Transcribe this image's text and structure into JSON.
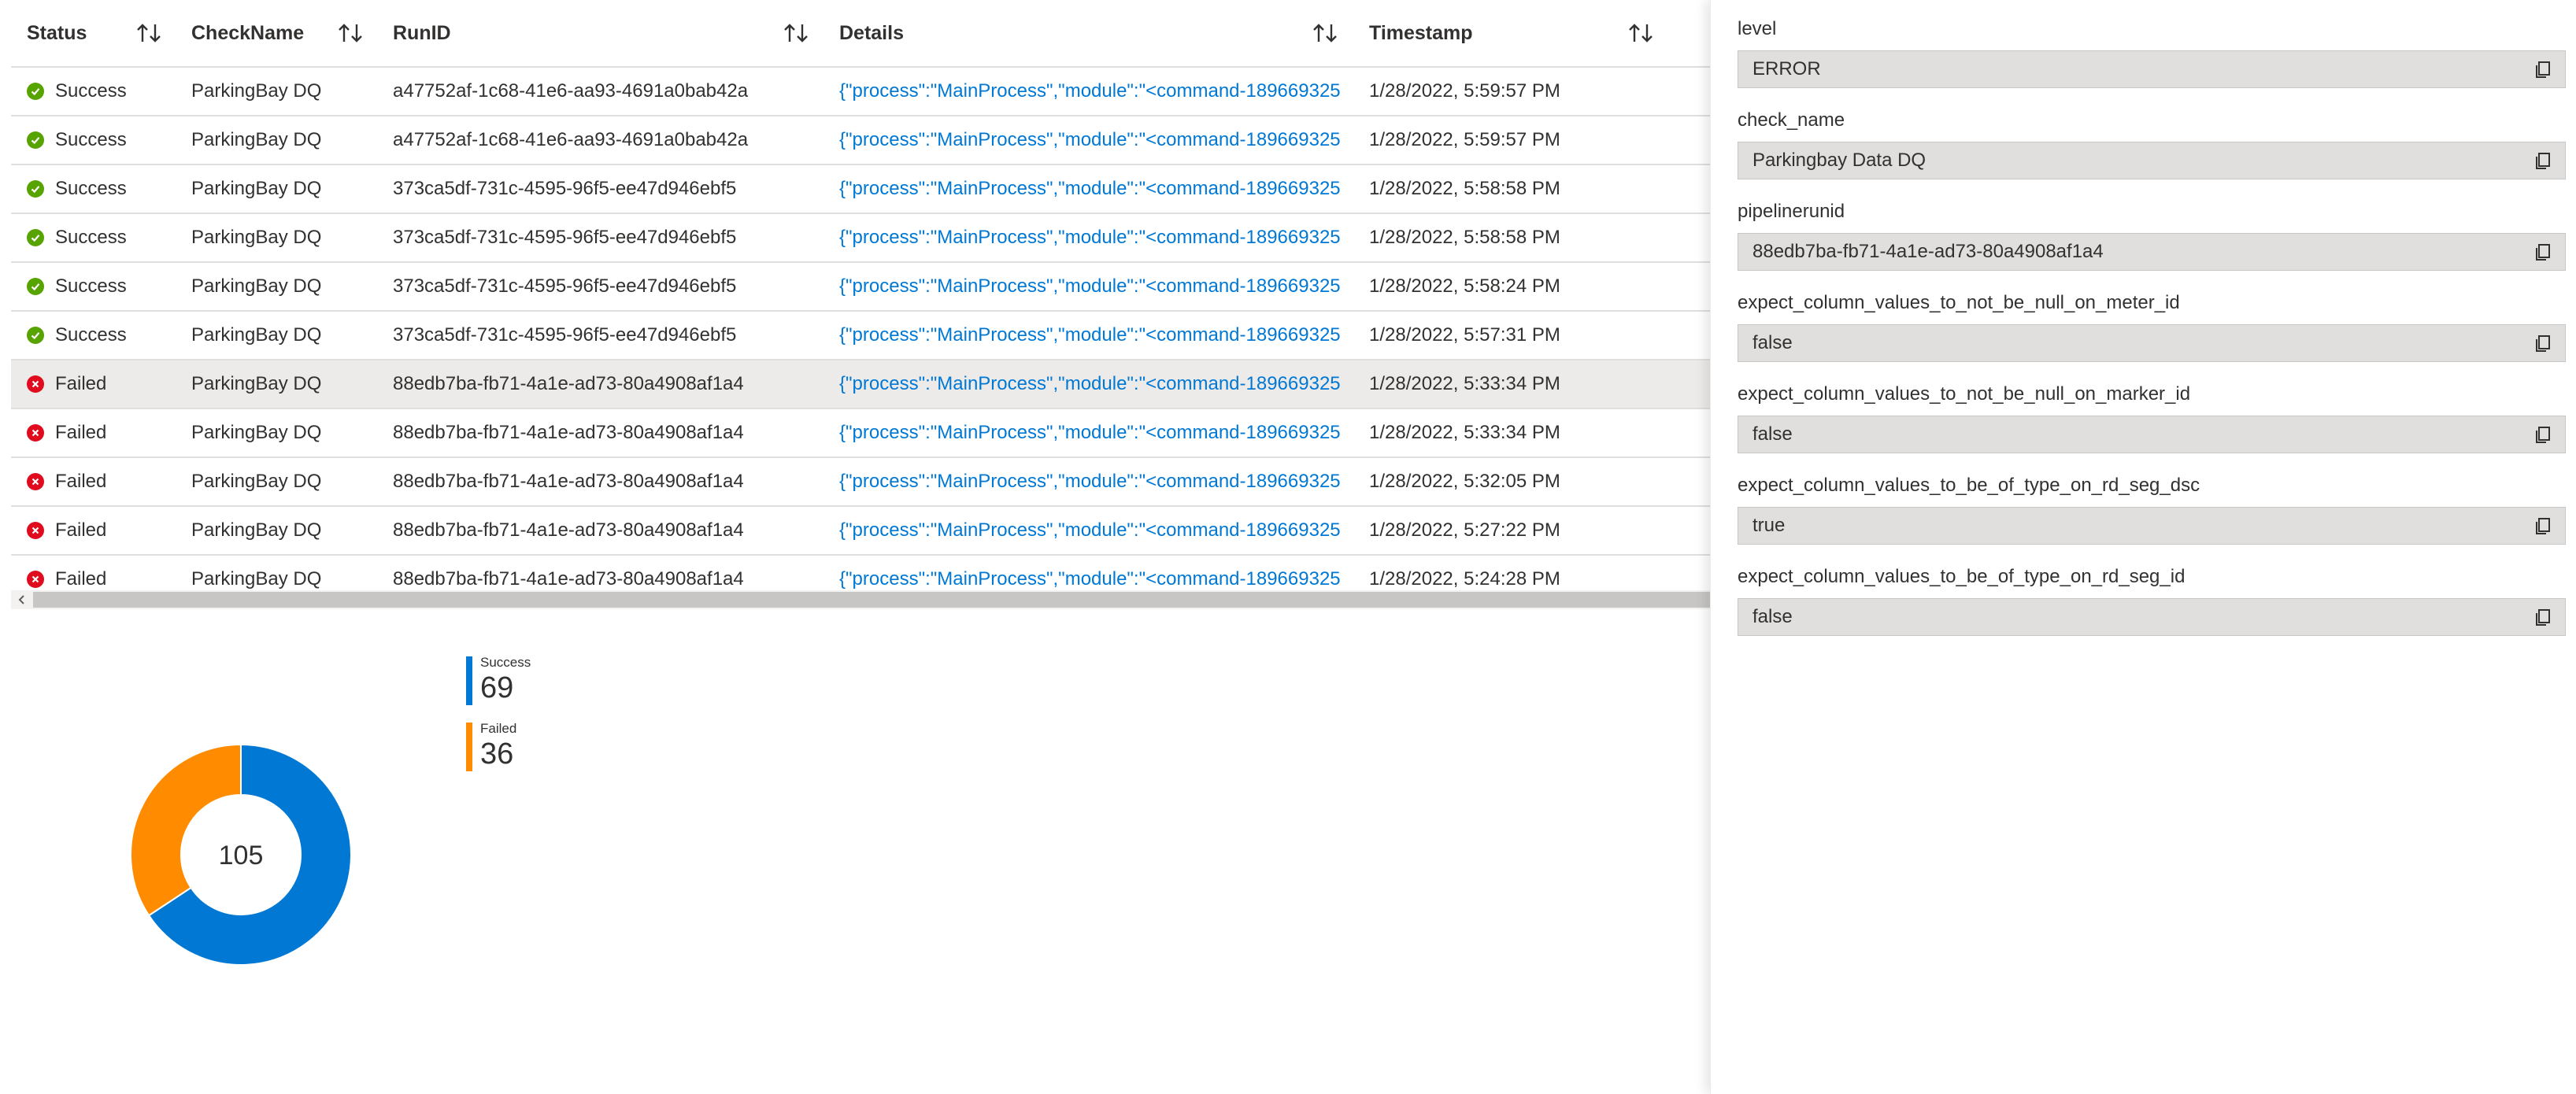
{
  "table": {
    "columns": [
      {
        "key": "status",
        "label": "Status"
      },
      {
        "key": "check",
        "label": "CheckName"
      },
      {
        "key": "run",
        "label": "RunID"
      },
      {
        "key": "details",
        "label": "Details"
      },
      {
        "key": "ts",
        "label": "Timestamp"
      }
    ],
    "rows": [
      {
        "status": "Success",
        "check": "ParkingBay DQ",
        "run": "a47752af-1c68-41e6-aa93-4691a0bab42a",
        "details": "{\"process\":\"MainProcess\",\"module\":\"<command-189669325",
        "ts": "1/28/2022, 5:59:57 PM",
        "ok": true,
        "selected": false
      },
      {
        "status": "Success",
        "check": "ParkingBay DQ",
        "run": "a47752af-1c68-41e6-aa93-4691a0bab42a",
        "details": "{\"process\":\"MainProcess\",\"module\":\"<command-189669325",
        "ts": "1/28/2022, 5:59:57 PM",
        "ok": true,
        "selected": false
      },
      {
        "status": "Success",
        "check": "ParkingBay DQ",
        "run": "373ca5df-731c-4595-96f5-ee47d946ebf5",
        "details": "{\"process\":\"MainProcess\",\"module\":\"<command-189669325",
        "ts": "1/28/2022, 5:58:58 PM",
        "ok": true,
        "selected": false
      },
      {
        "status": "Success",
        "check": "ParkingBay DQ",
        "run": "373ca5df-731c-4595-96f5-ee47d946ebf5",
        "details": "{\"process\":\"MainProcess\",\"module\":\"<command-189669325",
        "ts": "1/28/2022, 5:58:58 PM",
        "ok": true,
        "selected": false
      },
      {
        "status": "Success",
        "check": "ParkingBay DQ",
        "run": "373ca5df-731c-4595-96f5-ee47d946ebf5",
        "details": "{\"process\":\"MainProcess\",\"module\":\"<command-189669325",
        "ts": "1/28/2022, 5:58:24 PM",
        "ok": true,
        "selected": false
      },
      {
        "status": "Success",
        "check": "ParkingBay DQ",
        "run": "373ca5df-731c-4595-96f5-ee47d946ebf5",
        "details": "{\"process\":\"MainProcess\",\"module\":\"<command-189669325",
        "ts": "1/28/2022, 5:57:31 PM",
        "ok": true,
        "selected": false
      },
      {
        "status": "Failed",
        "check": "ParkingBay DQ",
        "run": "88edb7ba-fb71-4a1e-ad73-80a4908af1a4",
        "details": "{\"process\":\"MainProcess\",\"module\":\"<command-189669325",
        "ts": "1/28/2022, 5:33:34 PM",
        "ok": false,
        "selected": true
      },
      {
        "status": "Failed",
        "check": "ParkingBay DQ",
        "run": "88edb7ba-fb71-4a1e-ad73-80a4908af1a4",
        "details": "{\"process\":\"MainProcess\",\"module\":\"<command-189669325",
        "ts": "1/28/2022, 5:33:34 PM",
        "ok": false,
        "selected": false
      },
      {
        "status": "Failed",
        "check": "ParkingBay DQ",
        "run": "88edb7ba-fb71-4a1e-ad73-80a4908af1a4",
        "details": "{\"process\":\"MainProcess\",\"module\":\"<command-189669325",
        "ts": "1/28/2022, 5:32:05 PM",
        "ok": false,
        "selected": false
      },
      {
        "status": "Failed",
        "check": "ParkingBay DQ",
        "run": "88edb7ba-fb71-4a1e-ad73-80a4908af1a4",
        "details": "{\"process\":\"MainProcess\",\"module\":\"<command-189669325",
        "ts": "1/28/2022, 5:27:22 PM",
        "ok": false,
        "selected": false
      },
      {
        "status": "Failed",
        "check": "ParkingBay DQ",
        "run": "88edb7ba-fb71-4a1e-ad73-80a4908af1a4",
        "details": "{\"process\":\"MainProcess\",\"module\":\"<command-189669325",
        "ts": "1/28/2022, 5:24:28 PM",
        "ok": false,
        "selected": false
      }
    ]
  },
  "summary": {
    "total": "105",
    "legend": [
      {
        "label": "Success",
        "value": "69",
        "color": "#0078d4"
      },
      {
        "label": "Failed",
        "value": "36",
        "color": "#ff8c00"
      }
    ]
  },
  "chart_data": {
    "type": "pie",
    "categories": [
      "Success",
      "Failed"
    ],
    "values": [
      69,
      36
    ],
    "center_label": "105",
    "colors": [
      "#0078d4",
      "#ff8c00"
    ]
  },
  "panel": {
    "fields": [
      {
        "label": "level",
        "value": "ERROR"
      },
      {
        "label": "check_name",
        "value": "Parkingbay Data DQ"
      },
      {
        "label": "pipelinerunid",
        "value": "88edb7ba-fb71-4a1e-ad73-80a4908af1a4"
      },
      {
        "label": "expect_column_values_to_not_be_null_on_meter_id",
        "value": "false"
      },
      {
        "label": "expect_column_values_to_not_be_null_on_marker_id",
        "value": "false"
      },
      {
        "label": "expect_column_values_to_be_of_type_on_rd_seg_dsc",
        "value": "true"
      },
      {
        "label": "expect_column_values_to_be_of_type_on_rd_seg_id",
        "value": "false"
      }
    ],
    "copy_icon": "copy-icon"
  },
  "icons": {
    "sort": "sort-arrows-icon",
    "success": "check-circle-icon",
    "failed": "error-circle-icon",
    "scroll_left": "chevron-left-icon"
  }
}
